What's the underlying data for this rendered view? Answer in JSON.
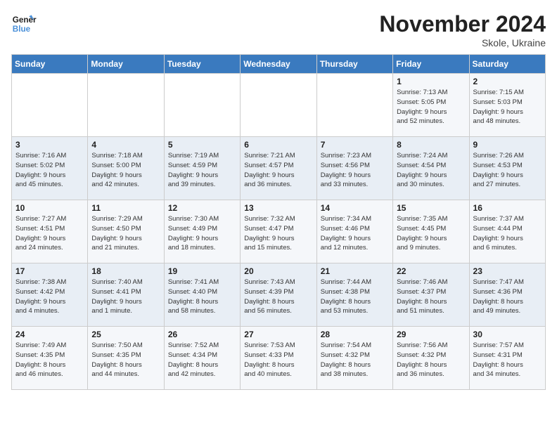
{
  "logo": {
    "line1": "General",
    "line2": "Blue"
  },
  "title": "November 2024",
  "location": "Skole, Ukraine",
  "days_of_week": [
    "Sunday",
    "Monday",
    "Tuesday",
    "Wednesday",
    "Thursday",
    "Friday",
    "Saturday"
  ],
  "weeks": [
    [
      {
        "day": "",
        "info": ""
      },
      {
        "day": "",
        "info": ""
      },
      {
        "day": "",
        "info": ""
      },
      {
        "day": "",
        "info": ""
      },
      {
        "day": "",
        "info": ""
      },
      {
        "day": "1",
        "info": "Sunrise: 7:13 AM\nSunset: 5:05 PM\nDaylight: 9 hours\nand 52 minutes."
      },
      {
        "day": "2",
        "info": "Sunrise: 7:15 AM\nSunset: 5:03 PM\nDaylight: 9 hours\nand 48 minutes."
      }
    ],
    [
      {
        "day": "3",
        "info": "Sunrise: 7:16 AM\nSunset: 5:02 PM\nDaylight: 9 hours\nand 45 minutes."
      },
      {
        "day": "4",
        "info": "Sunrise: 7:18 AM\nSunset: 5:00 PM\nDaylight: 9 hours\nand 42 minutes."
      },
      {
        "day": "5",
        "info": "Sunrise: 7:19 AM\nSunset: 4:59 PM\nDaylight: 9 hours\nand 39 minutes."
      },
      {
        "day": "6",
        "info": "Sunrise: 7:21 AM\nSunset: 4:57 PM\nDaylight: 9 hours\nand 36 minutes."
      },
      {
        "day": "7",
        "info": "Sunrise: 7:23 AM\nSunset: 4:56 PM\nDaylight: 9 hours\nand 33 minutes."
      },
      {
        "day": "8",
        "info": "Sunrise: 7:24 AM\nSunset: 4:54 PM\nDaylight: 9 hours\nand 30 minutes."
      },
      {
        "day": "9",
        "info": "Sunrise: 7:26 AM\nSunset: 4:53 PM\nDaylight: 9 hours\nand 27 minutes."
      }
    ],
    [
      {
        "day": "10",
        "info": "Sunrise: 7:27 AM\nSunset: 4:51 PM\nDaylight: 9 hours\nand 24 minutes."
      },
      {
        "day": "11",
        "info": "Sunrise: 7:29 AM\nSunset: 4:50 PM\nDaylight: 9 hours\nand 21 minutes."
      },
      {
        "day": "12",
        "info": "Sunrise: 7:30 AM\nSunset: 4:49 PM\nDaylight: 9 hours\nand 18 minutes."
      },
      {
        "day": "13",
        "info": "Sunrise: 7:32 AM\nSunset: 4:47 PM\nDaylight: 9 hours\nand 15 minutes."
      },
      {
        "day": "14",
        "info": "Sunrise: 7:34 AM\nSunset: 4:46 PM\nDaylight: 9 hours\nand 12 minutes."
      },
      {
        "day": "15",
        "info": "Sunrise: 7:35 AM\nSunset: 4:45 PM\nDaylight: 9 hours\nand 9 minutes."
      },
      {
        "day": "16",
        "info": "Sunrise: 7:37 AM\nSunset: 4:44 PM\nDaylight: 9 hours\nand 6 minutes."
      }
    ],
    [
      {
        "day": "17",
        "info": "Sunrise: 7:38 AM\nSunset: 4:42 PM\nDaylight: 9 hours\nand 4 minutes."
      },
      {
        "day": "18",
        "info": "Sunrise: 7:40 AM\nSunset: 4:41 PM\nDaylight: 9 hours\nand 1 minute."
      },
      {
        "day": "19",
        "info": "Sunrise: 7:41 AM\nSunset: 4:40 PM\nDaylight: 8 hours\nand 58 minutes."
      },
      {
        "day": "20",
        "info": "Sunrise: 7:43 AM\nSunset: 4:39 PM\nDaylight: 8 hours\nand 56 minutes."
      },
      {
        "day": "21",
        "info": "Sunrise: 7:44 AM\nSunset: 4:38 PM\nDaylight: 8 hours\nand 53 minutes."
      },
      {
        "day": "22",
        "info": "Sunrise: 7:46 AM\nSunset: 4:37 PM\nDaylight: 8 hours\nand 51 minutes."
      },
      {
        "day": "23",
        "info": "Sunrise: 7:47 AM\nSunset: 4:36 PM\nDaylight: 8 hours\nand 49 minutes."
      }
    ],
    [
      {
        "day": "24",
        "info": "Sunrise: 7:49 AM\nSunset: 4:35 PM\nDaylight: 8 hours\nand 46 minutes."
      },
      {
        "day": "25",
        "info": "Sunrise: 7:50 AM\nSunset: 4:35 PM\nDaylight: 8 hours\nand 44 minutes."
      },
      {
        "day": "26",
        "info": "Sunrise: 7:52 AM\nSunset: 4:34 PM\nDaylight: 8 hours\nand 42 minutes."
      },
      {
        "day": "27",
        "info": "Sunrise: 7:53 AM\nSunset: 4:33 PM\nDaylight: 8 hours\nand 40 minutes."
      },
      {
        "day": "28",
        "info": "Sunrise: 7:54 AM\nSunset: 4:32 PM\nDaylight: 8 hours\nand 38 minutes."
      },
      {
        "day": "29",
        "info": "Sunrise: 7:56 AM\nSunset: 4:32 PM\nDaylight: 8 hours\nand 36 minutes."
      },
      {
        "day": "30",
        "info": "Sunrise: 7:57 AM\nSunset: 4:31 PM\nDaylight: 8 hours\nand 34 minutes."
      }
    ]
  ]
}
